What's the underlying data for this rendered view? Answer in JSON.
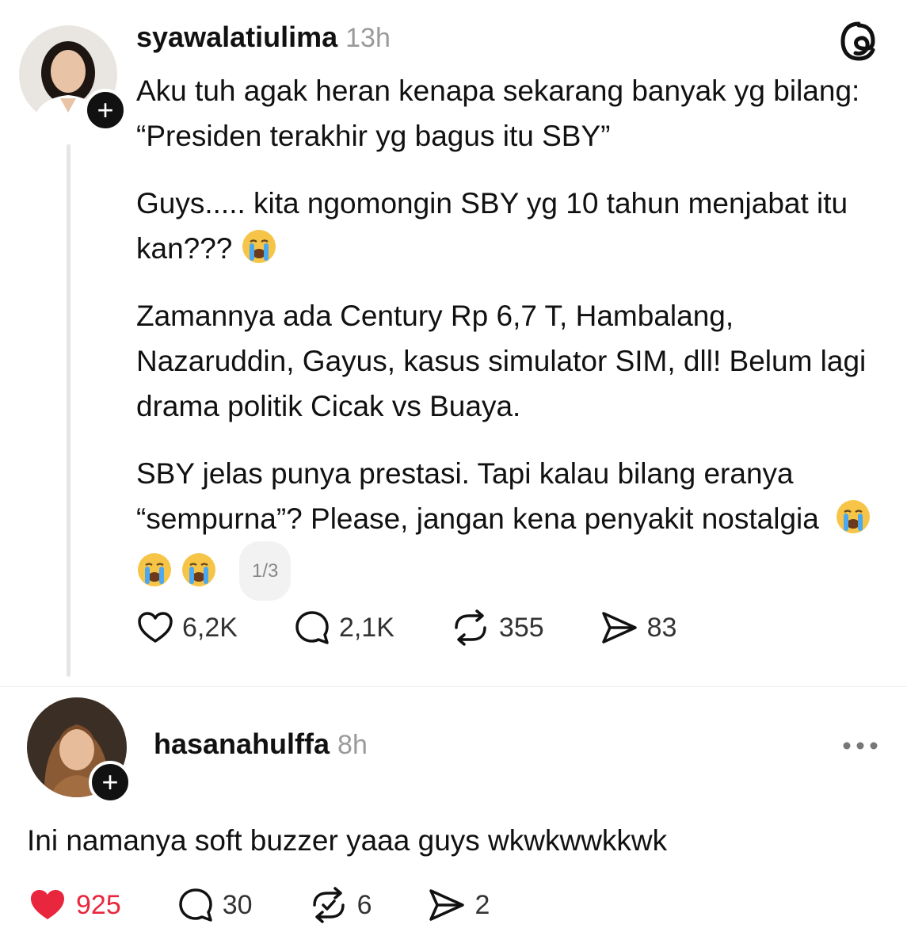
{
  "post": {
    "username": "syawalatiulima",
    "time": "13h",
    "paragraph1": "Aku tuh agak heran kenapa sekarang banyak yg bilang: “Presiden terakhir yg bagus itu SBY”",
    "paragraph2": "Guys..... kita ngomongin SBY yg 10 tahun menjabat itu kan???",
    "paragraph3": "Zamannya ada Century Rp 6,7 T, Hambalang, Nazaruddin, Gayus, kasus simulator SIM, dll! Belum lagi drama politik Cicak vs Buaya.",
    "paragraph4": "SBY jelas punya prestasi. Tapi kalau bilang eranya “sempurna”? Please, jangan kena penyakit nostalgia",
    "page_indicator": "1/3",
    "likes": "6,2K",
    "comments": "2,1K",
    "reposts": "355",
    "shares": "83"
  },
  "reply": {
    "username": "hasanahulffa",
    "time": "8h",
    "text": "Ini namanya soft buzzer yaaa guys wkwkwwkkwk",
    "likes": "925",
    "comments": "30",
    "reposts": "6",
    "shares": "2"
  },
  "icons": {
    "app_logo": "threads-logo-icon",
    "like": "heart-icon",
    "comment": "comment-bubble-icon",
    "repost": "repost-icon",
    "share": "send-icon",
    "more": "more-dots-icon",
    "follow": "plus-icon",
    "emoji": "loudly-crying-face"
  },
  "colors": {
    "liked": "#e8263d",
    "muted": "#9a9a9a",
    "text": "#111111"
  }
}
